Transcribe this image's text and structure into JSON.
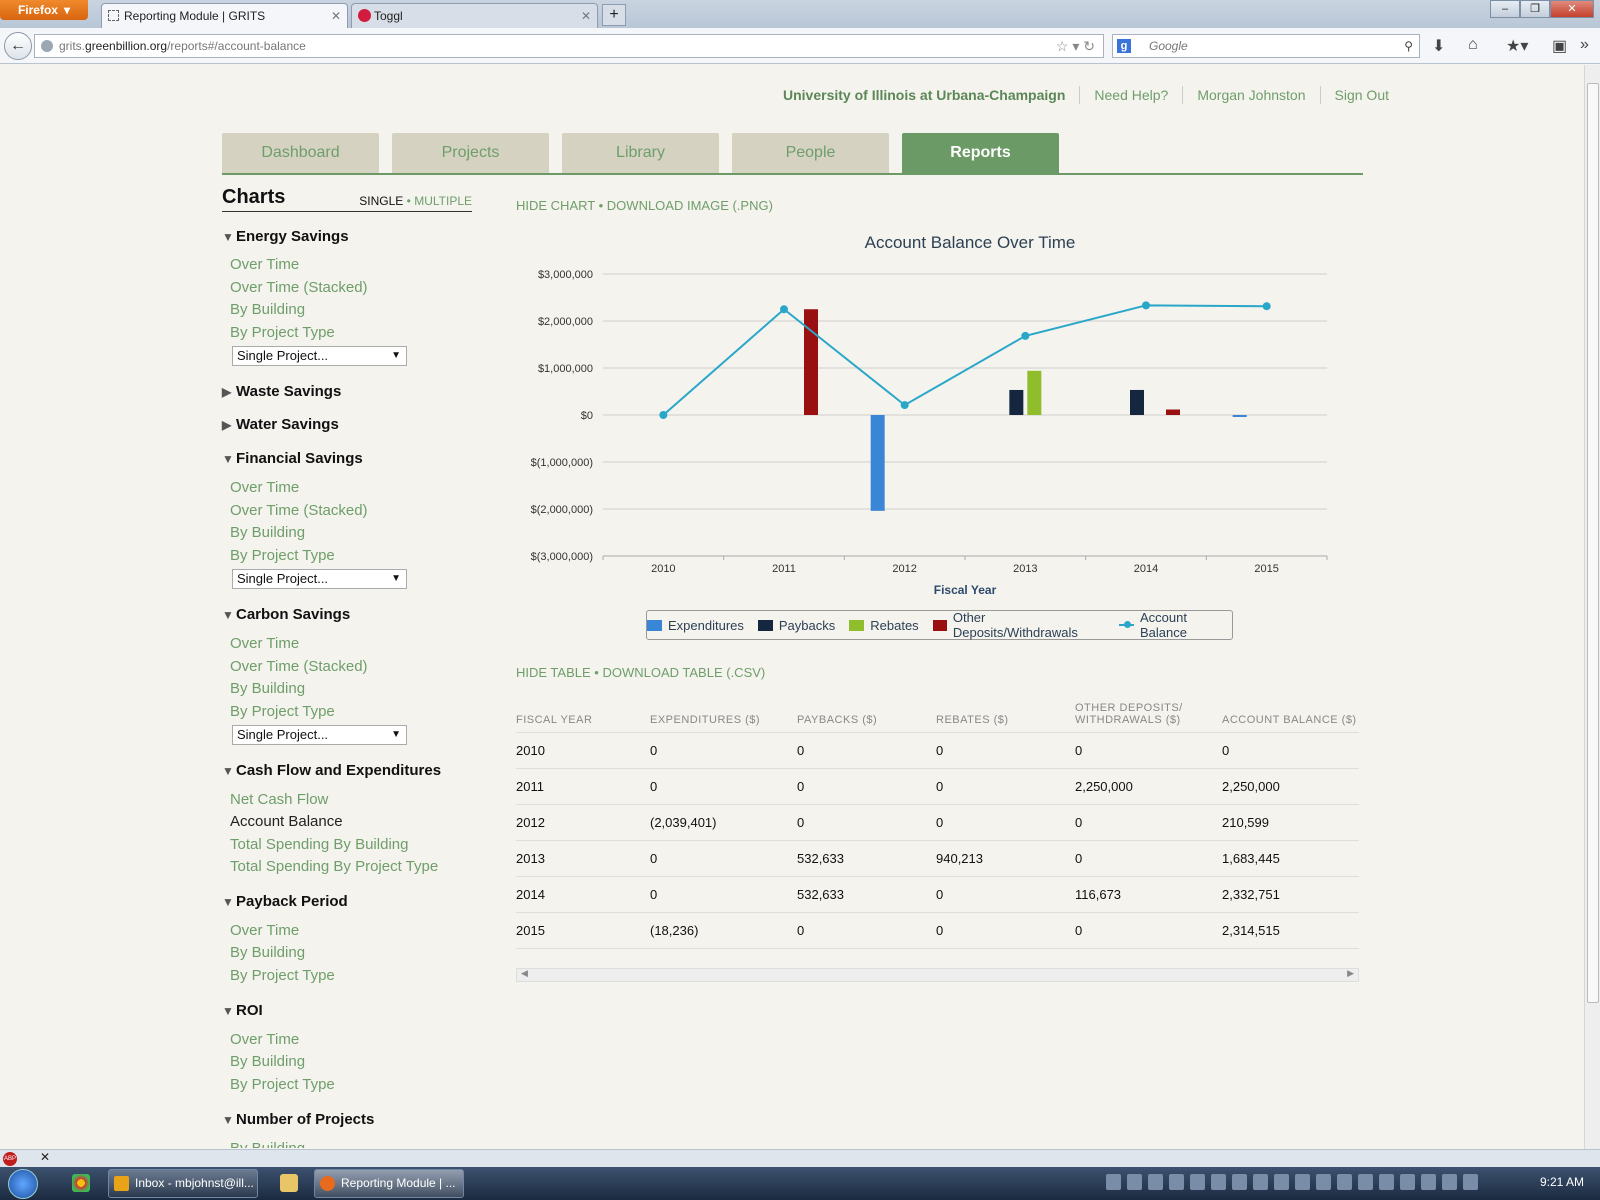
{
  "browser": {
    "menu_label": "Firefox",
    "tabs": [
      {
        "title": "Reporting Module | GRITS"
      },
      {
        "title": "Toggl"
      }
    ],
    "url_prefix": "grits.",
    "url_domain": "greenbillion.org",
    "url_path": "/reports#/account-balance",
    "search_placeholder": "Google"
  },
  "top_links": {
    "institution": "University of Illinois at Urbana-Champaign",
    "help": "Need Help?",
    "user": "Morgan Johnston",
    "signout": "Sign Out"
  },
  "main_nav": {
    "tabs": [
      {
        "label": "Dashboard"
      },
      {
        "label": "Projects"
      },
      {
        "label": "Library"
      },
      {
        "label": "People"
      },
      {
        "label": "Reports"
      }
    ],
    "active": "Reports"
  },
  "sidebar": {
    "title": "Charts",
    "mode_single": "SINGLE",
    "mode_sep": "•",
    "mode_multiple": "MULTIPLE",
    "sections": [
      {
        "title": "Energy Savings",
        "expanded": true,
        "links": [
          "Over Time",
          "Over Time (Stacked)",
          "By Building",
          "By Project Type"
        ],
        "select": "Single Project..."
      },
      {
        "title": "Waste Savings",
        "expanded": false
      },
      {
        "title": "Water Savings",
        "expanded": false
      },
      {
        "title": "Financial Savings",
        "expanded": true,
        "links": [
          "Over Time",
          "Over Time (Stacked)",
          "By Building",
          "By Project Type"
        ],
        "select": "Single Project..."
      },
      {
        "title": "Carbon Savings",
        "expanded": true,
        "links": [
          "Over Time",
          "Over Time (Stacked)",
          "By Building",
          "By Project Type"
        ],
        "select": "Single Project..."
      },
      {
        "title": "Cash Flow and Expenditures",
        "expanded": true,
        "links": [
          "Net Cash Flow",
          "Account Balance",
          "Total Spending By Building",
          "Total Spending By Project Type"
        ],
        "current": "Account Balance"
      },
      {
        "title": "Payback Period",
        "expanded": true,
        "links": [
          "Over Time",
          "By Building",
          "By Project Type"
        ]
      },
      {
        "title": "ROI",
        "expanded": true,
        "links": [
          "Over Time",
          "By Building",
          "By Project Type"
        ]
      },
      {
        "title": "Number of Projects",
        "expanded": true,
        "links": [
          "By Building"
        ]
      }
    ]
  },
  "chart_actions": {
    "hide": "HIDE CHART",
    "sep": "•",
    "download": "DOWNLOAD IMAGE (.PNG)"
  },
  "table_actions": {
    "hide": "HIDE TABLE",
    "sep": "•",
    "download": "DOWNLOAD TABLE (.CSV)"
  },
  "chart_data": {
    "type": "bar",
    "title": "Account Balance Over Time",
    "xlabel": "Fiscal Year",
    "ylabel": "",
    "categories": [
      "2010",
      "2011",
      "2012",
      "2013",
      "2014",
      "2015"
    ],
    "ylim": [
      -3000000,
      3000000
    ],
    "yticks": [
      "$3,000,000",
      "$2,000,000",
      "$1,000,000",
      "$0",
      "$(1,000,000)",
      "$(2,000,000)",
      "$(3,000,000)"
    ],
    "ytick_values": [
      3000000,
      2000000,
      1000000,
      0,
      -1000000,
      -2000000,
      -3000000
    ],
    "grid": true,
    "legend_position": "bottom",
    "series": [
      {
        "name": "Expenditures",
        "kind": "bar",
        "color": "#3a86d6",
        "values": [
          0,
          0,
          -2039401,
          0,
          0,
          -18236
        ]
      },
      {
        "name": "Paybacks",
        "kind": "bar",
        "color": "#15273f",
        "values": [
          0,
          0,
          0,
          532633,
          532633,
          0
        ]
      },
      {
        "name": "Rebates",
        "kind": "bar",
        "color": "#8fbd2b",
        "values": [
          0,
          0,
          0,
          940213,
          0,
          0
        ]
      },
      {
        "name": "Other Deposits/Withdrawals",
        "kind": "bar",
        "color": "#9a0f0f",
        "values": [
          0,
          2250000,
          0,
          0,
          116673,
          0
        ]
      },
      {
        "name": "Account Balance",
        "kind": "line",
        "color": "#29a7c9",
        "values": [
          0,
          2250000,
          210599,
          1683445,
          2332751,
          2314515
        ]
      }
    ]
  },
  "table": {
    "headers": [
      "FISCAL YEAR",
      "EXPENDITURES ($)",
      "PAYBACKS ($)",
      "REBATES ($)",
      "OTHER DEPOSITS/ WITHDRAWALS ($)",
      "ACCOUNT BALANCE ($)"
    ],
    "rows": [
      [
        "2010",
        "0",
        "0",
        "0",
        "0",
        "0"
      ],
      [
        "2011",
        "0",
        "0",
        "0",
        "2,250,000",
        "2,250,000"
      ],
      [
        "2012",
        "(2,039,401)",
        "0",
        "0",
        "0",
        "210,599"
      ],
      [
        "2013",
        "0",
        "532,633",
        "940,213",
        "0",
        "1,683,445"
      ],
      [
        "2014",
        "0",
        "532,633",
        "0",
        "116,673",
        "2,332,751"
      ],
      [
        "2015",
        "(18,236)",
        "0",
        "0",
        "0",
        "2,314,515"
      ]
    ]
  },
  "taskbar": {
    "items": [
      {
        "label": "Inbox - mbjohnst@ill..."
      },
      {
        "label": "Reporting Module | ..."
      }
    ],
    "clock": "9:21 AM"
  },
  "colors": {
    "accent": "#6b9a66",
    "link": "#6e9e6a",
    "tab_inactive": "#d6d2c2"
  }
}
